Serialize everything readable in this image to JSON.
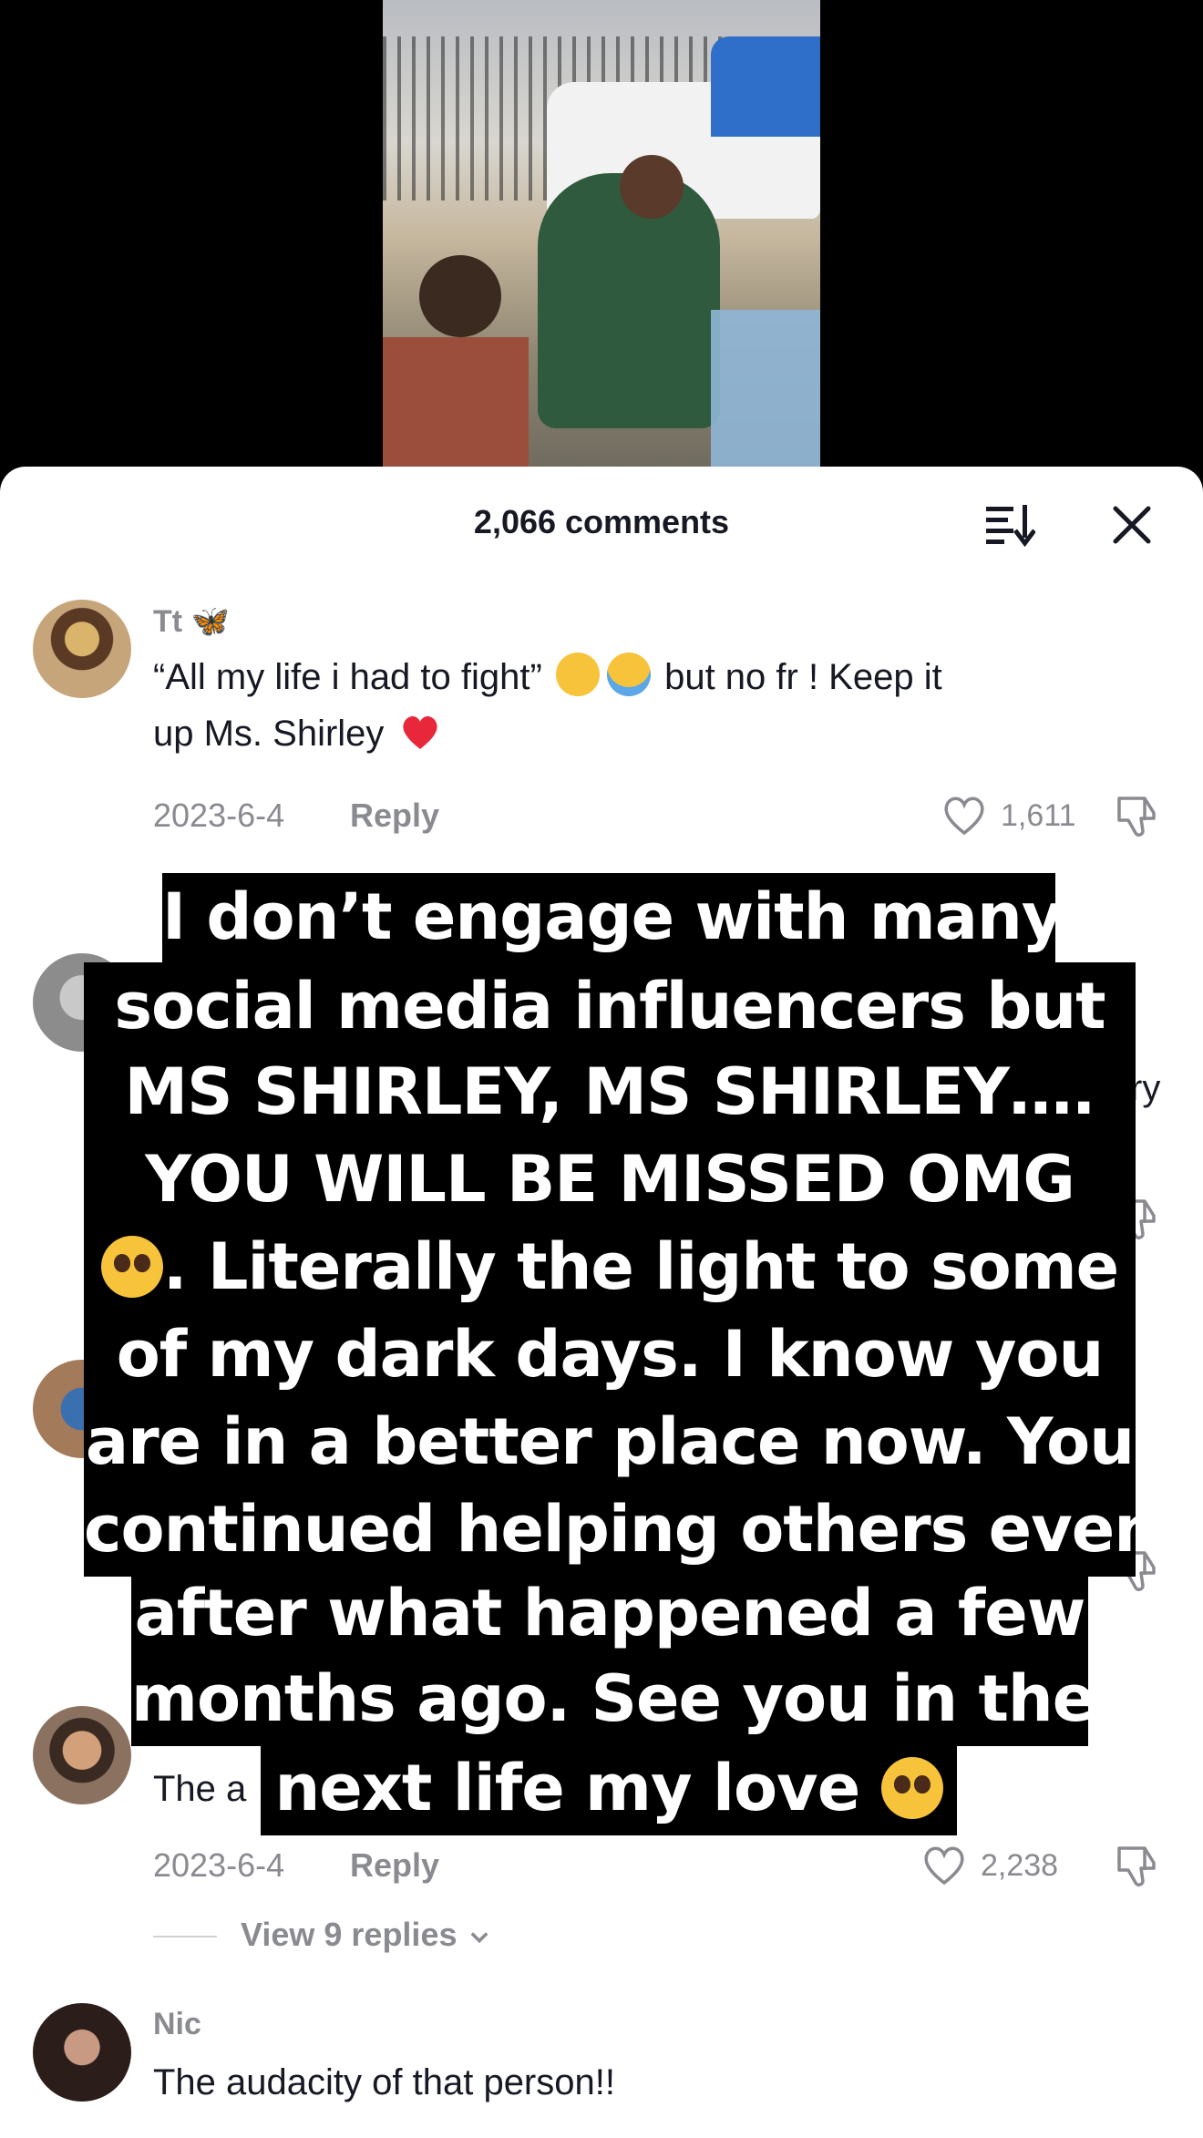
{
  "header": {
    "comment_count": "2,066 comments"
  },
  "comments": [
    {
      "username": "Tt 🦋",
      "text_line1": "“All my life i had to fight”",
      "text_line1b": "but no fr ! Keep it",
      "text_line2": "up Ms. Shirley",
      "date": "2023-6-4",
      "reply": "Reply",
      "likes": "1,611"
    },
    {
      "username": "",
      "text": "The a",
      "date": "2023-6-4",
      "reply": "Reply",
      "likes": "2,238",
      "view_replies": "View 9 replies"
    },
    {
      "username": "Nic",
      "text": "The audacity of that person!!"
    }
  ],
  "partial_text": {
    "side_fragment": "ry"
  },
  "caption": {
    "lines": [
      "I don’t engage with many",
      "social media influencers but",
      "MS SHIRLEY, MS SHIRLEY….",
      "YOU WILL BE MISSED OMG",
      ". Literally the light to some",
      "of my dark days. I know you",
      "are in a better place now. You",
      "continued helping others even",
      "after what happened a few",
      "months ago. See you in the",
      "next life my love"
    ]
  },
  "icons": {
    "sort": "sort-icon",
    "close": "close-icon",
    "heart": "heart-icon",
    "dislike": "thumbs-down-icon",
    "emoji_laugh": "rolling-laughing-emoji",
    "emoji_cry": "crying-emoji",
    "emoji_heart": "red-heart-emoji",
    "emoji_pleading": "pleading-face-emoji"
  },
  "colors": {
    "text": "#161823",
    "muted": "#8a8b91",
    "heart_red": "#e8273b"
  }
}
